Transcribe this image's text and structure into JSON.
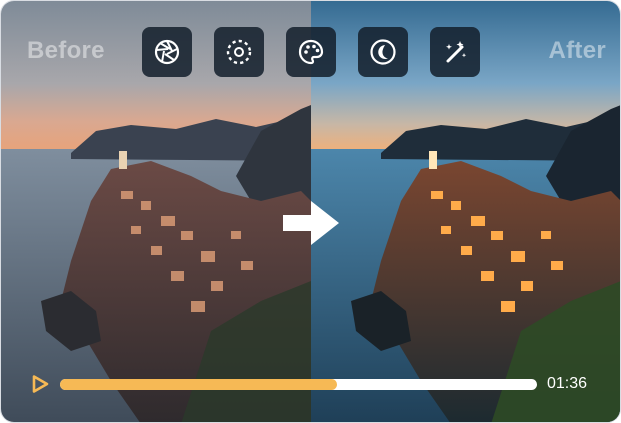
{
  "labels": {
    "before": "Before",
    "after": "After"
  },
  "toolbar": {
    "items": [
      {
        "name": "aperture-icon"
      },
      {
        "name": "dotted-circle-icon"
      },
      {
        "name": "palette-icon"
      },
      {
        "name": "moon-icon"
      },
      {
        "name": "magic-wand-icon"
      }
    ]
  },
  "player": {
    "time": "01:36",
    "progress": 0.58,
    "accent": "#f6b955"
  },
  "colors": {
    "before_sky_top": "#8d98a5",
    "before_horizon": "#e8a37a",
    "after_sky_top": "#3a6f95",
    "after_horizon": "#f0b07a"
  }
}
